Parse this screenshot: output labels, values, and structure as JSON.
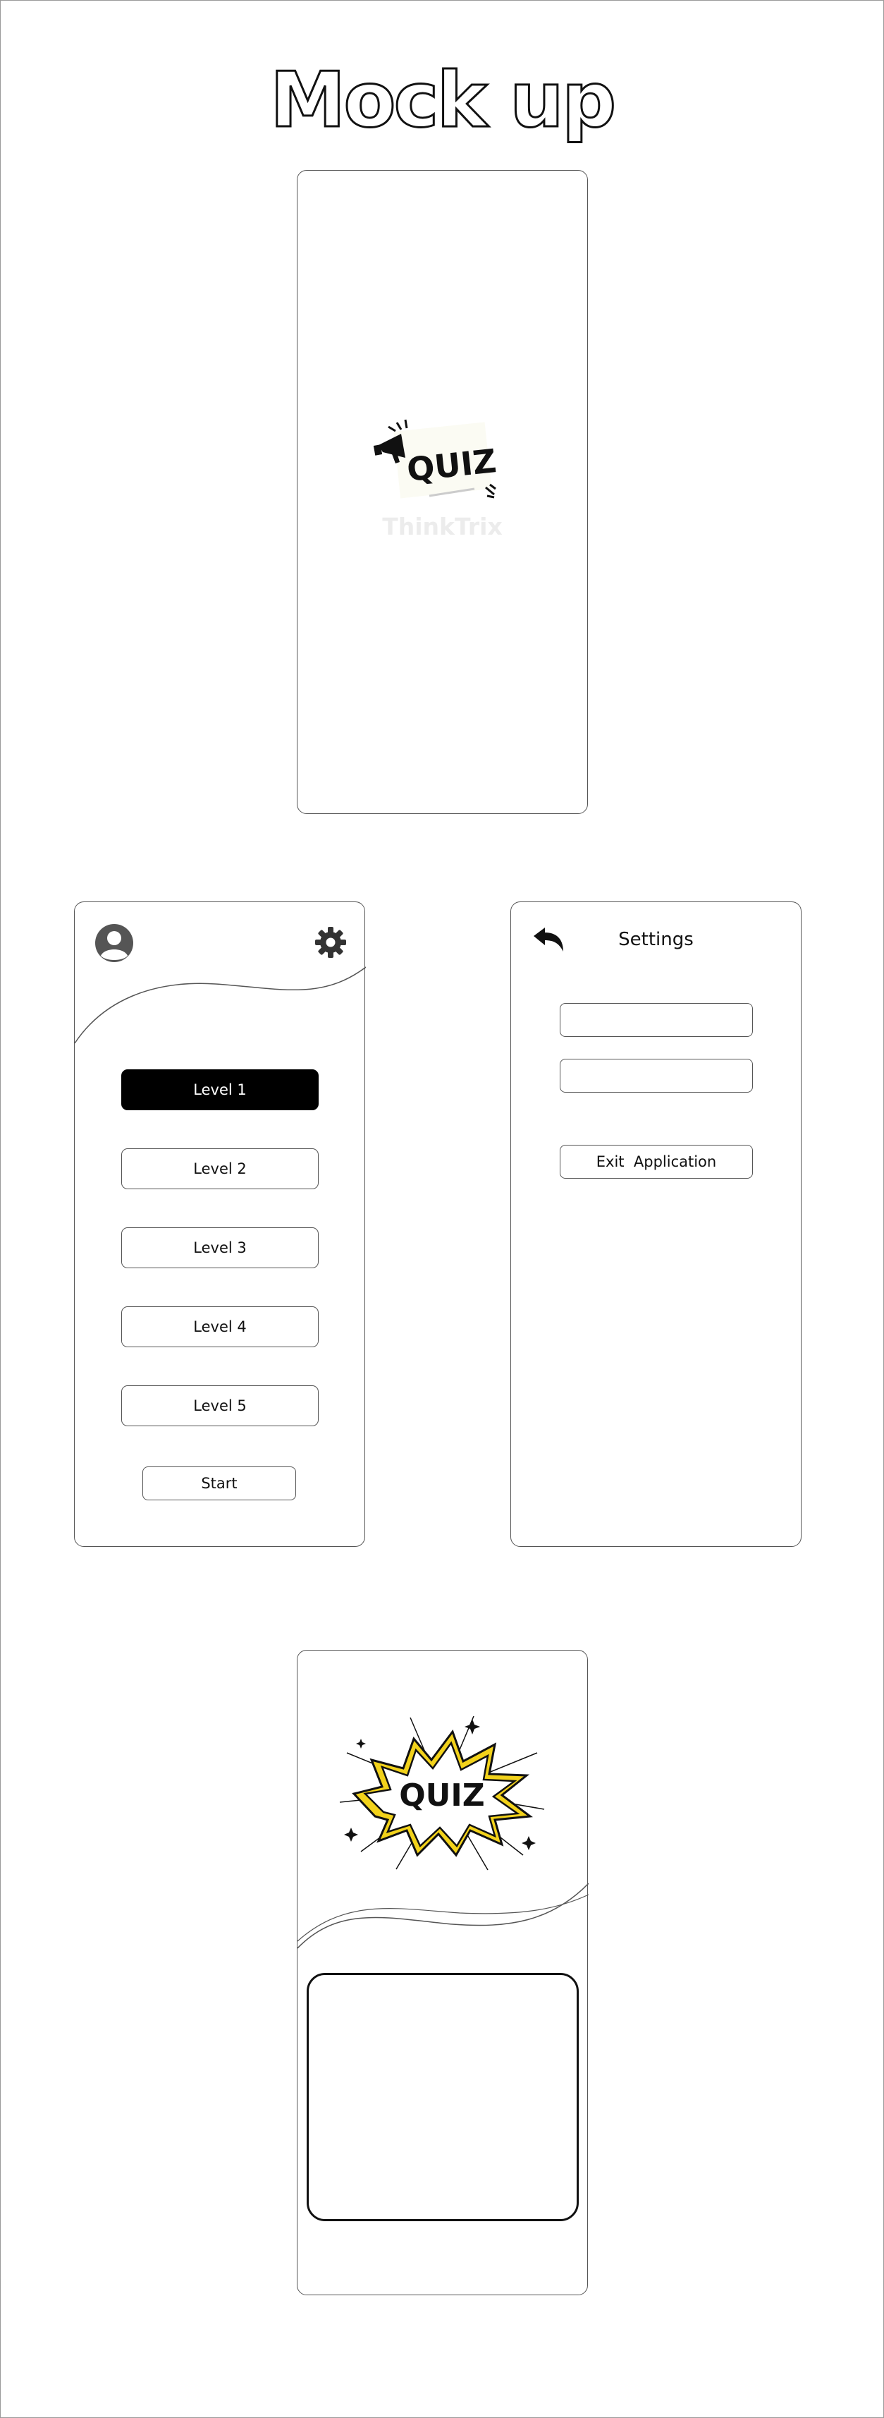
{
  "title": "Mock up",
  "splash": {
    "logo_text": "QUIZ",
    "brand": "ThinkTrix"
  },
  "levels_screen": {
    "icons": {
      "profile": "user-avatar-icon",
      "settings": "gear-icon"
    },
    "levels": [
      "Level 1",
      "Level 2",
      "Level 3",
      "Level 4",
      "Level 5"
    ],
    "selected_level": "Level 1",
    "start_label": "Start"
  },
  "settings_screen": {
    "icons": {
      "back": "back-arrow-icon"
    },
    "title": "Settings",
    "field_1": "",
    "field_2": "",
    "exit_label": "Exit  Application"
  },
  "quiz_screen": {
    "logo_text": "QUIZ",
    "answer_box": ""
  },
  "colors": {
    "accent_yellow": "#f2d21b",
    "selected_button": "#000000"
  }
}
